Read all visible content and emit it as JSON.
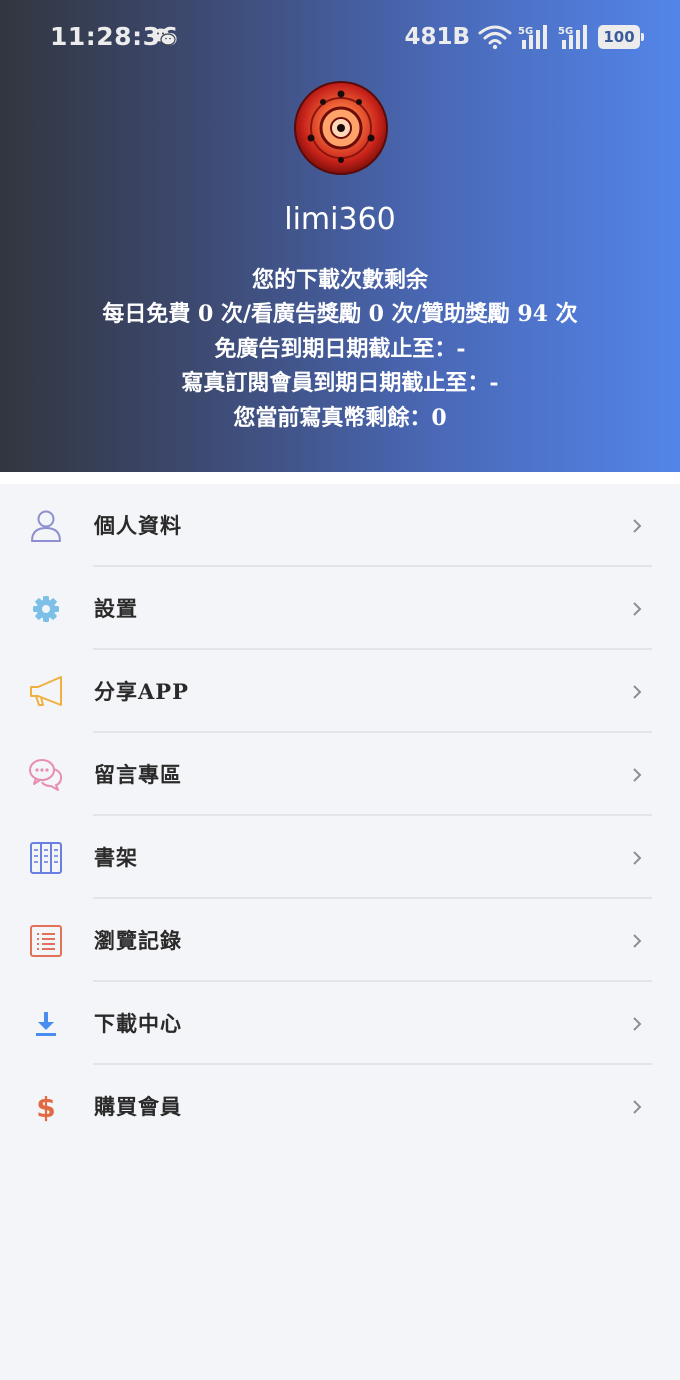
{
  "status_bar": {
    "time": "11:28:36",
    "net_speed": "481B",
    "battery": "100"
  },
  "profile": {
    "username": "limi360",
    "lines": [
      "您的下載次數剩余",
      "每日免費 0 次/看廣告獎勵 0 次/贊助獎勵 94 次",
      "免廣告到期日期截止至：-",
      "寫真訂閱會員到期日期截止至：-",
      "您當前寫真幣剩餘：0"
    ]
  },
  "menu": {
    "items": [
      {
        "label": "個人資料",
        "icon": "user-icon",
        "color": "#8e8fce"
      },
      {
        "label": "設置",
        "icon": "gear-icon",
        "color": "#7cc0e8"
      },
      {
        "label": "分享APP",
        "icon": "megaphone-icon",
        "color": "#f0b040"
      },
      {
        "label": "留言專區",
        "icon": "chat-bubbles-icon",
        "color": "#e78fb0"
      },
      {
        "label": "書架",
        "icon": "bookshelf-icon",
        "color": "#6a7fe0"
      },
      {
        "label": "瀏覽記錄",
        "icon": "history-list-icon",
        "color": "#e2715a"
      },
      {
        "label": "下載中心",
        "icon": "download-icon",
        "color": "#4a8df0"
      },
      {
        "label": "購買會員",
        "icon": "dollar-icon",
        "color": "#e26a42"
      }
    ]
  },
  "colors": {
    "header_gradient_start": "#32363f",
    "header_gradient_end": "#5385e9",
    "background": "#f4f5f8"
  }
}
